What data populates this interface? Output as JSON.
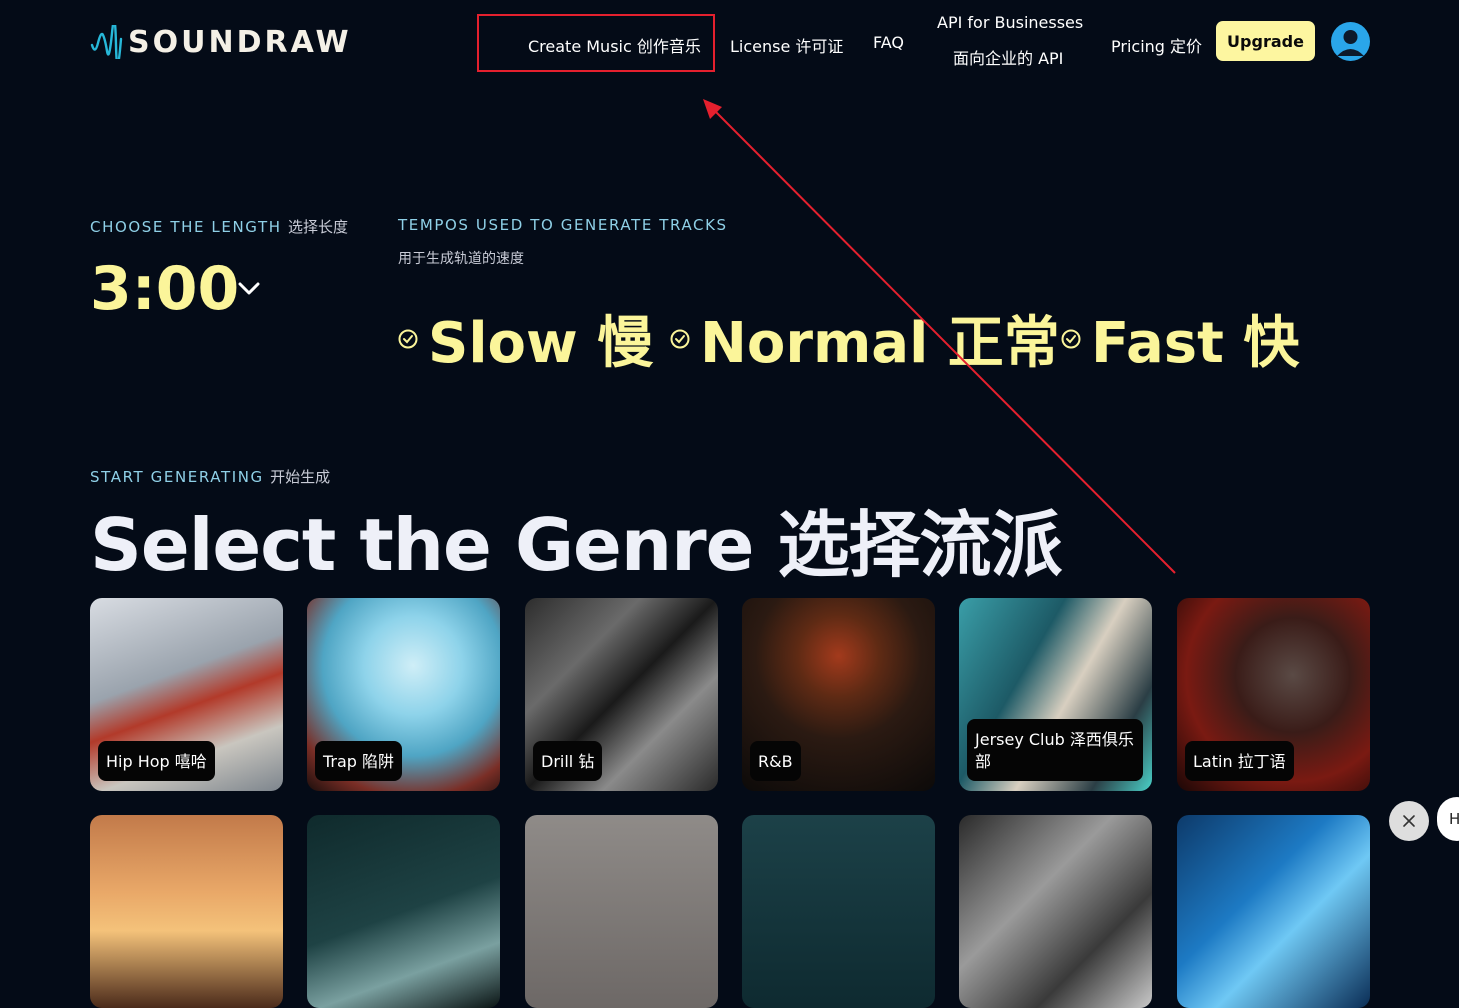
{
  "logo": {
    "text": "SOUNDRAW",
    "icon": "soundwave-icon"
  },
  "nav": {
    "create_music": "Create Music 创作音乐",
    "license": "License 许可证",
    "faq": "FAQ",
    "api_line1": "API for Businesses",
    "api_line2": "面向企业的 API",
    "pricing": "Pricing 定价",
    "upgrade": "Upgrade"
  },
  "length_section": {
    "label_en": "CHOOSE THE LENGTH",
    "label_cn": "选择长度",
    "value": "3:00"
  },
  "tempo_section": {
    "label_en": "TEMPOS USED TO GENERATE TRACKS",
    "label_cn": "用于生成轨道的速度",
    "options": [
      "Slow 慢",
      "Normal 正常",
      "Fast 快"
    ]
  },
  "genre_section": {
    "eyebrow_en": "START GENERATING",
    "eyebrow_cn": "开始生成",
    "title": "Select the Genre 选择流派",
    "genres": [
      "Hip Hop 嘻哈",
      "Trap 陷阱",
      "Drill 钻",
      "R&B",
      "Jersey Club 泽西俱乐部",
      "Latin 拉丁语"
    ]
  },
  "chat": {
    "bubble_text": "H"
  },
  "colors": {
    "accent_yellow": "#fbf59a",
    "background": "#040b17",
    "highlight_red": "#e5202e",
    "avatar_blue": "#2aa6ea"
  }
}
